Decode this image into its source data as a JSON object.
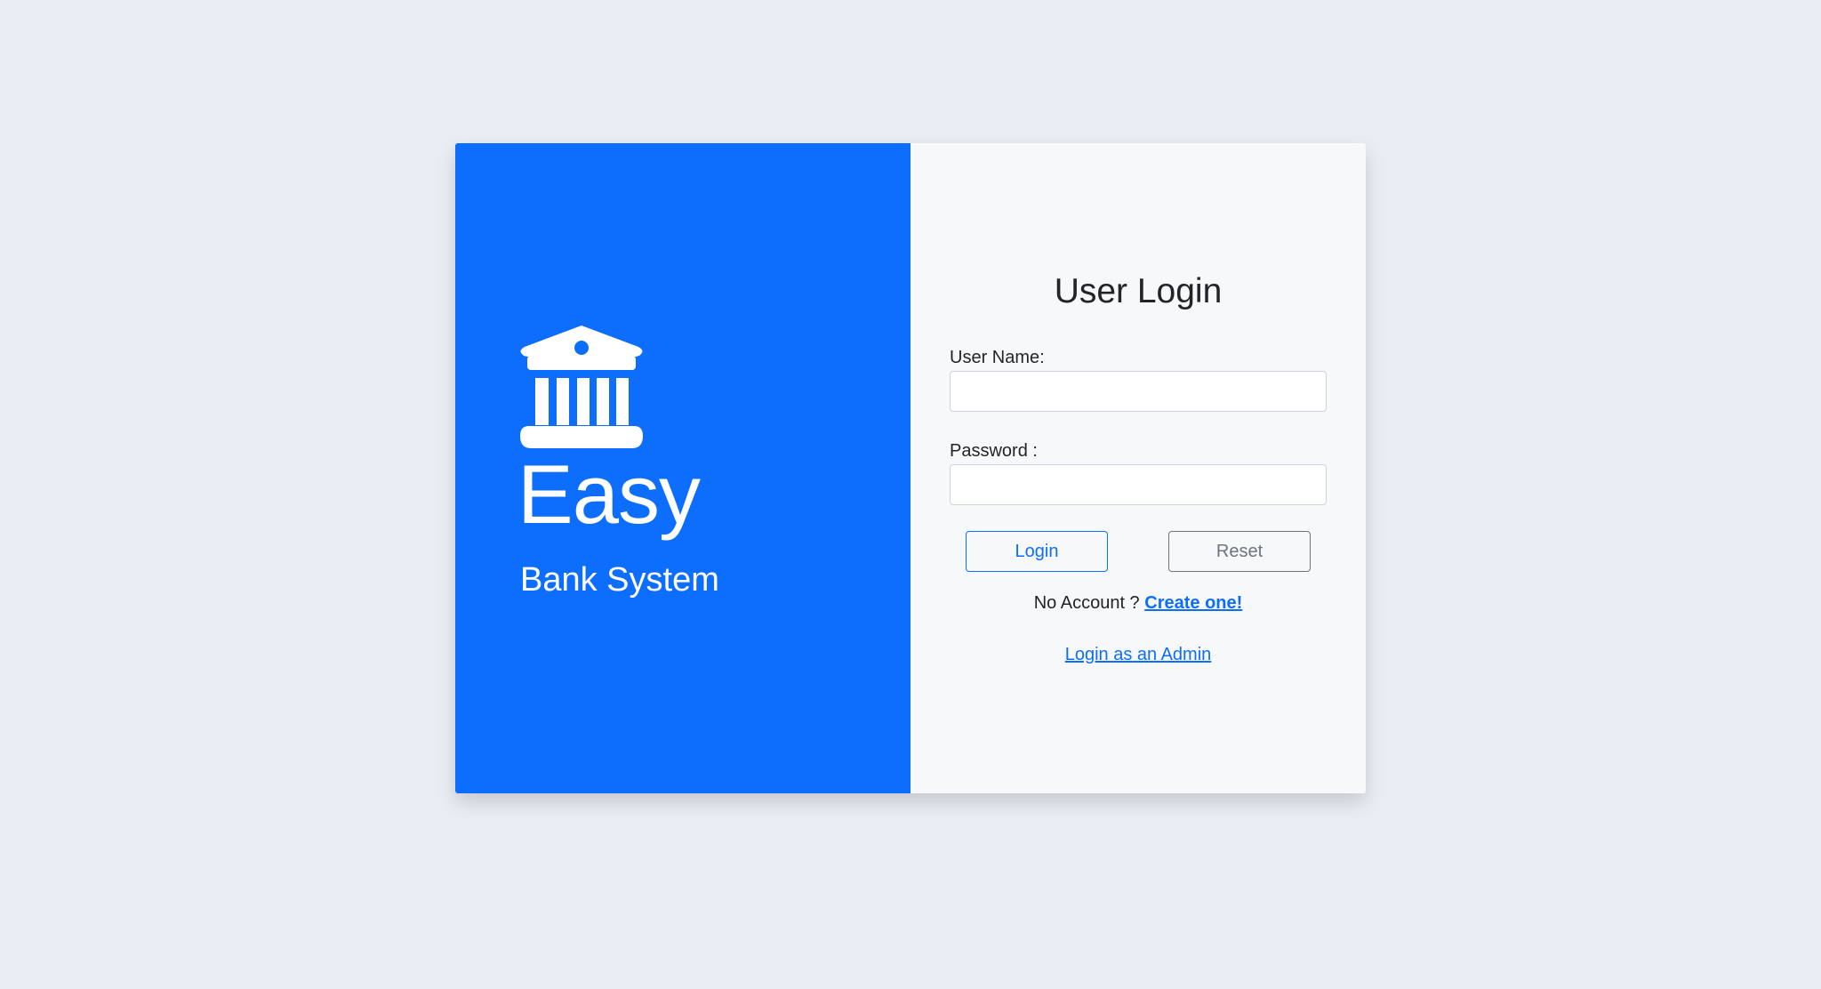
{
  "brand": {
    "icon": "bank-icon",
    "title": "Easy",
    "subtitle": "Bank System",
    "color": "#0d6efd"
  },
  "login_form": {
    "heading": "User Login",
    "username_label": "User Name:",
    "username_value": "",
    "password_label": "Password :",
    "password_value": "",
    "login_button": "Login",
    "reset_button": "Reset",
    "no_account_text": "No Account ?",
    "create_account_link": "Create one!",
    "admin_link": "Login as an Admin"
  },
  "colors": {
    "page_background": "#e9edf4",
    "accent": "#0d6efd",
    "secondary": "#6c757d"
  }
}
